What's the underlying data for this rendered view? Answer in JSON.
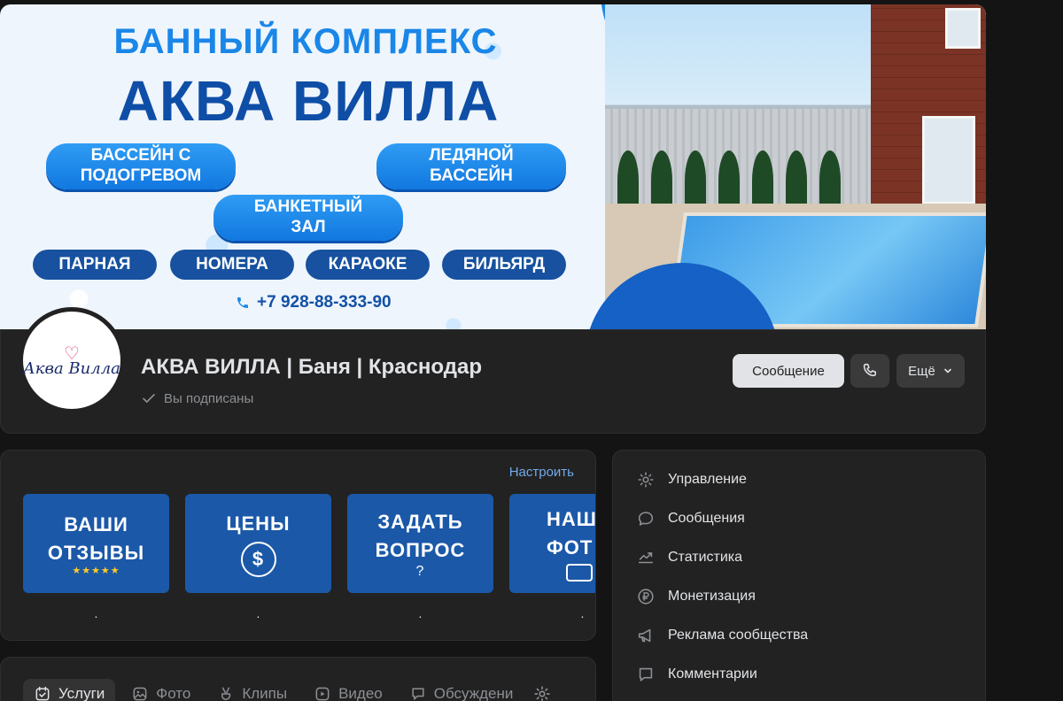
{
  "cover": {
    "kicker": "БАННЫЙ КОМПЛЕКС",
    "title": "АКВА ВИЛЛА",
    "pills": [
      "БАССЕЙН С ПОДОГРЕВОМ",
      "ЛЕДЯНОЙ БАССЕЙН",
      "БАНКЕТНЫЙ ЗАЛ",
      "ПАРНАЯ",
      "НОМЕРА",
      "КАРАОКЕ",
      "БИЛЬЯРД"
    ],
    "phone": "+7 928-88-333-90"
  },
  "avatar": {
    "text": "Аква Вилла"
  },
  "header": {
    "name": "АКВА ВИЛЛА | Баня | Краснодар",
    "status": "Вы подписаны",
    "message_button": "Сообщение",
    "more_button": "Ещё"
  },
  "widgets": {
    "configure": "Настроить",
    "tiles": [
      {
        "line1": "ВАШИ",
        "line2": "ОТЗЫВЫ",
        "stars": "★★★★★",
        "caption": "."
      },
      {
        "line1": "ЦЕНЫ",
        "symbol": "$",
        "caption": "."
      },
      {
        "line1": "ЗАДАТЬ",
        "line2": "ВОПРОС",
        "symbol": "?",
        "caption": "."
      },
      {
        "line1": "НАШ",
        "line2": "ФОТ",
        "caption": "."
      }
    ]
  },
  "tabs": [
    {
      "label": "Услуги",
      "icon": "calendar-check-icon",
      "active": true
    },
    {
      "label": "Фото",
      "icon": "image-icon"
    },
    {
      "label": "Клипы",
      "icon": "clips-icon"
    },
    {
      "label": "Видео",
      "icon": "video-icon"
    },
    {
      "label": "Обсуждени",
      "icon": "discussion-icon"
    }
  ],
  "menu": [
    {
      "label": "Управление",
      "icon": "gear-icon"
    },
    {
      "label": "Сообщения",
      "icon": "message-icon"
    },
    {
      "label": "Статистика",
      "icon": "chart-icon"
    },
    {
      "label": "Монетизация",
      "icon": "ruble-icon"
    },
    {
      "label": "Реклама сообщества",
      "icon": "megaphone-icon"
    },
    {
      "label": "Комментарии",
      "icon": "comment-icon"
    }
  ],
  "colors": {
    "background": "#141414",
    "panel": "#222222",
    "accent_link": "#71aaeb",
    "tile_blue": "#1b58a8",
    "cover_blue": "#1a86e8"
  }
}
